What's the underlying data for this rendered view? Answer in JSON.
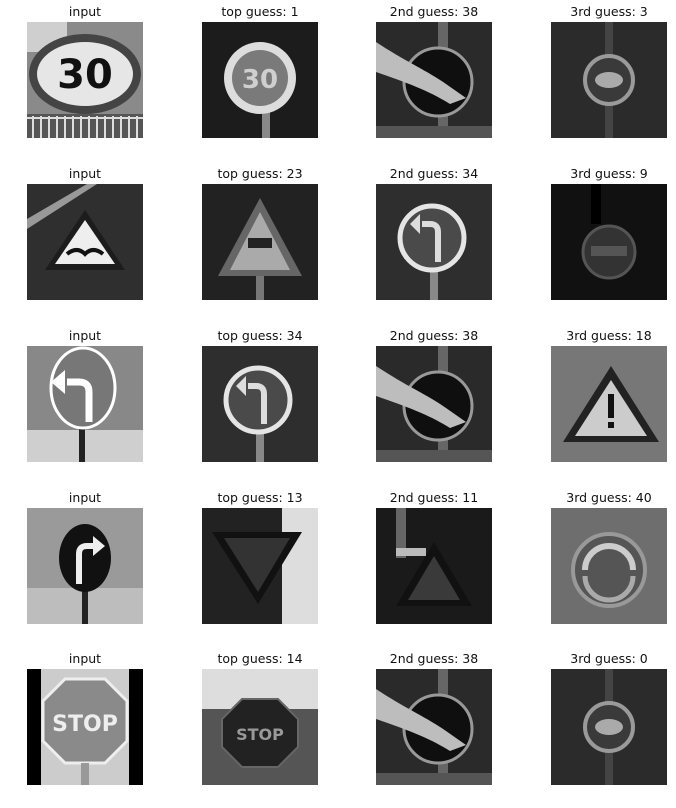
{
  "rows": [
    {
      "cells": [
        {
          "caption": "input",
          "sign": "speed-limit-30",
          "text": "30"
        },
        {
          "caption": "top guess: 1",
          "sign": "speed-limit-dark",
          "text": "30"
        },
        {
          "caption": "2nd guess: 38",
          "sign": "keep-right",
          "text": ""
        },
        {
          "caption": "3rd guess: 3",
          "sign": "speed-limit-dim",
          "text": ""
        }
      ]
    },
    {
      "cells": [
        {
          "caption": "input",
          "sign": "bumpy-road-triangle",
          "text": ""
        },
        {
          "caption": "top guess: 23",
          "sign": "slippery-road-triangle",
          "text": ""
        },
        {
          "caption": "2nd guess: 34",
          "sign": "turn-left-circle",
          "text": ""
        },
        {
          "caption": "3rd guess: 9",
          "sign": "dark-round",
          "text": ""
        }
      ]
    },
    {
      "cells": [
        {
          "caption": "input",
          "sign": "turn-left-outline",
          "text": ""
        },
        {
          "caption": "top guess: 34",
          "sign": "turn-left-circle",
          "text": ""
        },
        {
          "caption": "2nd guess: 38",
          "sign": "keep-right",
          "text": ""
        },
        {
          "caption": "3rd guess: 18",
          "sign": "caution-triangle",
          "text": ""
        }
      ]
    },
    {
      "cells": [
        {
          "caption": "input",
          "sign": "turn-right-dark",
          "text": ""
        },
        {
          "caption": "top guess: 13",
          "sign": "yield-dark",
          "text": ""
        },
        {
          "caption": "2nd guess: 11",
          "sign": "triangle-dark",
          "text": ""
        },
        {
          "caption": "3rd guess: 40",
          "sign": "roundabout",
          "text": ""
        }
      ]
    },
    {
      "cells": [
        {
          "caption": "input",
          "sign": "stop-input",
          "text": "STOP"
        },
        {
          "caption": "top guess: 14",
          "sign": "stop-dark",
          "text": "STOP"
        },
        {
          "caption": "2nd guess: 38",
          "sign": "keep-right",
          "text": ""
        },
        {
          "caption": "3rd guess: 0",
          "sign": "speed-limit-dim",
          "text": ""
        }
      ]
    }
  ]
}
